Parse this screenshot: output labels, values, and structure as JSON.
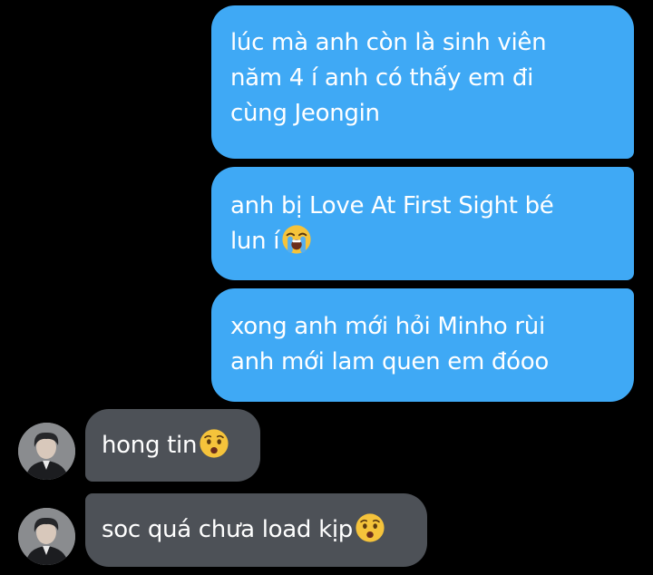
{
  "messages": [
    {
      "direction": "sent",
      "lines": [
        "lúc mà anh còn là sinh viên",
        "năm 4 í anh có thấy em đi",
        "cùng Jeongin"
      ]
    },
    {
      "direction": "sent",
      "lines": [
        "anh bị Love At First Sight bé",
        "lun í"
      ],
      "emoji": "loudly-crying-face"
    },
    {
      "direction": "sent",
      "lines": [
        "xong anh mới hỏi Minho rùi",
        "anh mới lam quen em đóoo"
      ]
    },
    {
      "direction": "received",
      "lines": [
        "hong tin"
      ],
      "emoji": "anxious-face"
    },
    {
      "direction": "received",
      "lines": [
        "soc quá chưa load kịp"
      ],
      "emoji": "anxious-face"
    }
  ],
  "colors": {
    "background": "#000000",
    "sent_bubble": "#3fa9f5",
    "received_bubble": "#4d5157",
    "text": "#ffffff"
  }
}
